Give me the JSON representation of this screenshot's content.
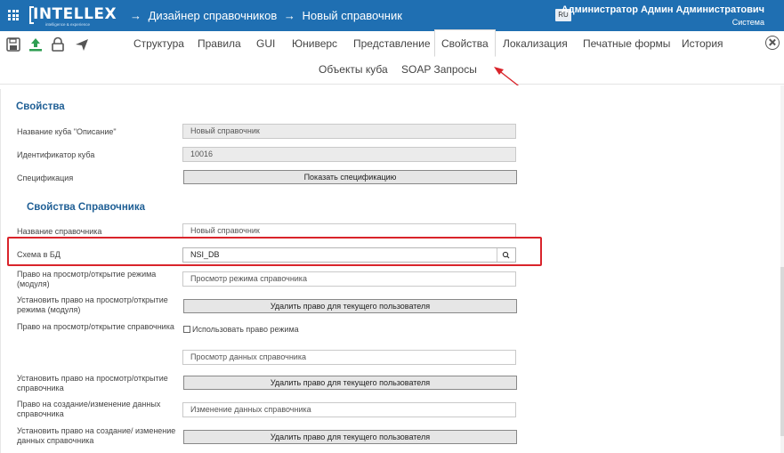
{
  "header": {
    "logo_text": "INTELLEX",
    "logo_tagline": "intelligence & experience",
    "breadcrumb": [
      "→",
      "Дизайнер справочников",
      "→",
      "Новый справочник"
    ],
    "lang": "RU",
    "user_name": "Администратор Админ Администратович",
    "user_role": "Система"
  },
  "toolbar_icons": [
    "save-icon",
    "upload-icon",
    "lock-icon",
    "send-icon"
  ],
  "tabs": [
    {
      "label": "Структура"
    },
    {
      "label": "Правила"
    },
    {
      "label": "GUI"
    },
    {
      "label": "Юниверс"
    },
    {
      "label": "Представление"
    },
    {
      "label": "Свойства",
      "active": true
    },
    {
      "label": "Локализация"
    },
    {
      "label": "Печатные формы"
    },
    {
      "label": "История"
    }
  ],
  "subtabs": [
    {
      "label": "Объекты куба"
    },
    {
      "label": "SOAP Запросы"
    }
  ],
  "section1": {
    "title": "Свойства",
    "cube_name_label": "Название куба \"Описание\"",
    "cube_name_value": "Новый справочник",
    "cube_id_label": "Идентификатор куба",
    "cube_id_value": "10016",
    "spec_label": "Спецификация",
    "spec_button": "Показать спецификацию"
  },
  "section2": {
    "title": "Свойства Справочника",
    "dict_name_label": "Название справочника",
    "dict_name_placeholder": "Новый справочник",
    "schema_label": "Схема в БД",
    "schema_value": "NSI_DB",
    "view_mode_label": "Право на просмотр/открытие режима (модуля)",
    "view_mode_placeholder": "Просмотр режима справочника",
    "set_view_mode_label": "Установить право на просмотр/открытие режима (модуля)",
    "delete_right_button": "Удалить право для текущего пользователя",
    "view_dict_label": "Право на просмотр/открытие справочника",
    "use_mode_right_checkbox": "Использовать право режима",
    "view_data_placeholder": "Просмотр данных справочника",
    "set_view_dict_label": "Установить право на просмотр/открытие справочника",
    "edit_data_label": "Право на создание/изменение данных справочника",
    "edit_data_placeholder": "Изменение данных справочника",
    "set_edit_data_label": "Установить право на создание/ изменение данных справочника"
  },
  "colors": {
    "header_bg": "#1f6fb2",
    "section_title": "#1f5f95",
    "highlight": "#d9242b"
  }
}
